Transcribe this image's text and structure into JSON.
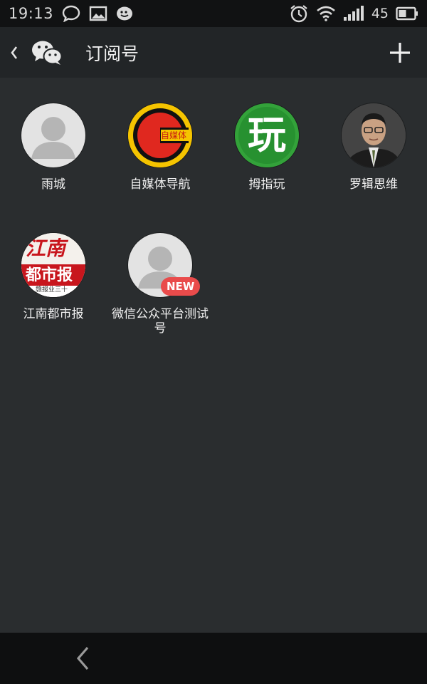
{
  "status_bar": {
    "time": "19:13",
    "battery": "45",
    "icons": [
      "chat-bubble-icon",
      "image-icon",
      "smiley-icon",
      "alarm-icon",
      "wifi-icon",
      "signal-icon",
      "battery-icon"
    ]
  },
  "header": {
    "title": "订阅号",
    "back_icon": "chevron-left-icon",
    "logo_icon": "wechat-icon",
    "add_icon": "plus-icon"
  },
  "accounts": [
    {
      "name": "雨城",
      "avatar": "default-person"
    },
    {
      "name": "自媒体导航",
      "avatar": "logo-c",
      "avatar_text": "自媒体"
    },
    {
      "name": "拇指玩",
      "avatar": "logo-wan",
      "avatar_text": "玩"
    },
    {
      "name": "罗辑思维",
      "avatar": "photo-man"
    },
    {
      "name": "江南都市报",
      "avatar": "logo-newspaper",
      "avatar_text_top": "江南",
      "avatar_text_mid": "都市报",
      "avatar_text_small": "赣报业三十"
    },
    {
      "name": "微信公众平台测试号",
      "avatar": "default-person",
      "badge": "NEW"
    }
  ],
  "colors": {
    "background": "#2a2d2f",
    "header": "#222527",
    "status_bar": "#111213",
    "badge": "#e94b4b"
  },
  "bottom_bar": {
    "back_icon": "nav-back-icon"
  }
}
